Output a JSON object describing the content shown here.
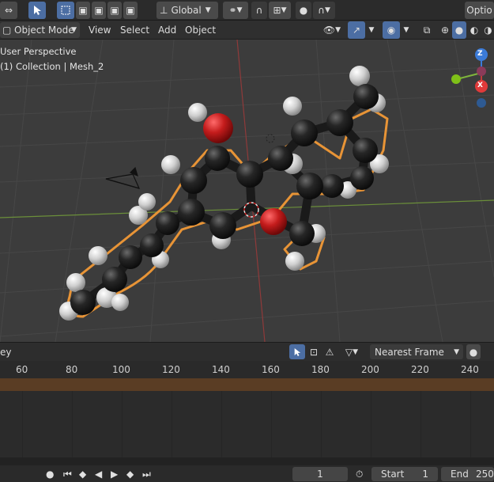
{
  "topbar": {
    "transform_orientation": "Global",
    "options_label": "Optio"
  },
  "header": {
    "mode": "Object Mode",
    "menus": [
      "View",
      "Select",
      "Add",
      "Object"
    ]
  },
  "viewport": {
    "view_name": "User Perspective",
    "collection_info": "(1) Collection | Mesh_2",
    "axis_labels": {
      "z": "Z",
      "x": "X"
    }
  },
  "timeline": {
    "partial_label": "ey",
    "snap_mode": "Nearest Frame",
    "ticks": [
      "60",
      "80",
      "100",
      "120",
      "140",
      "160",
      "180",
      "200",
      "220",
      "240"
    ]
  },
  "playback": {
    "current_frame": "1",
    "start_label": "Start",
    "start_value": "1",
    "end_label": "End",
    "end_value": "250"
  },
  "colors": {
    "carbon": "#222222",
    "hydrogen": "#d9d9d9",
    "oxygen": "#c41c1c",
    "outline": "#e89436",
    "accent": "#4c6ea3"
  }
}
